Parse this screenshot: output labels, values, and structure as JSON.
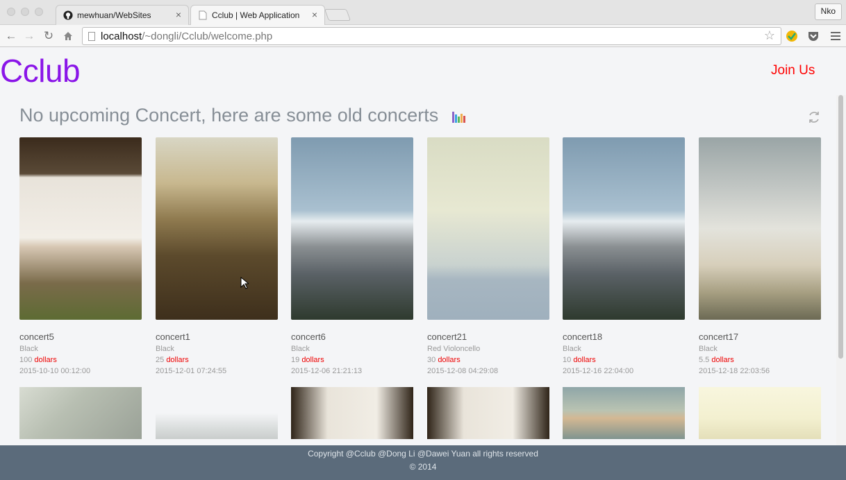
{
  "browser": {
    "tabs": [
      {
        "title": "mewhuan/WebSites",
        "icon": "github-icon"
      },
      {
        "title": "Cclub | Web Application",
        "icon": "page-icon"
      }
    ],
    "profile": "Nko",
    "url_host": "localhost",
    "url_path": "/~dongli/Cclub/welcome.php"
  },
  "header": {
    "logo": "Cclub",
    "join": "Join Us"
  },
  "main": {
    "heading": "No upcoming Concert, here are some old concerts",
    "currency_label": "dollars",
    "concerts": [
      {
        "name": "concert5",
        "artist": "Black",
        "price": "100",
        "date": "2015-10-10 00:12:00"
      },
      {
        "name": "concert1",
        "artist": "Black",
        "price": "25",
        "date": "2015-12-01 07:24:55"
      },
      {
        "name": "concert6",
        "artist": "Black",
        "price": "19",
        "date": "2015-12-06 21:21:13"
      },
      {
        "name": "concert21",
        "artist": "Red Violoncello",
        "price": "30",
        "date": "2015-12-08 04:29:08"
      },
      {
        "name": "concert18",
        "artist": "Black",
        "price": "10",
        "date": "2015-12-16 22:04:00"
      },
      {
        "name": "concert17",
        "artist": "Black",
        "price": "5.5",
        "date": "2015-12-18 22:03:56"
      }
    ]
  },
  "footer": {
    "line1": "Copyright @Cclub @Dong Li @Dawei Yuan all rights reserved",
    "line2": "© 2014"
  },
  "colors": {
    "brand": "#8a15e8",
    "accent": "#ff0000",
    "footer_bg": "#5b6b7b"
  }
}
